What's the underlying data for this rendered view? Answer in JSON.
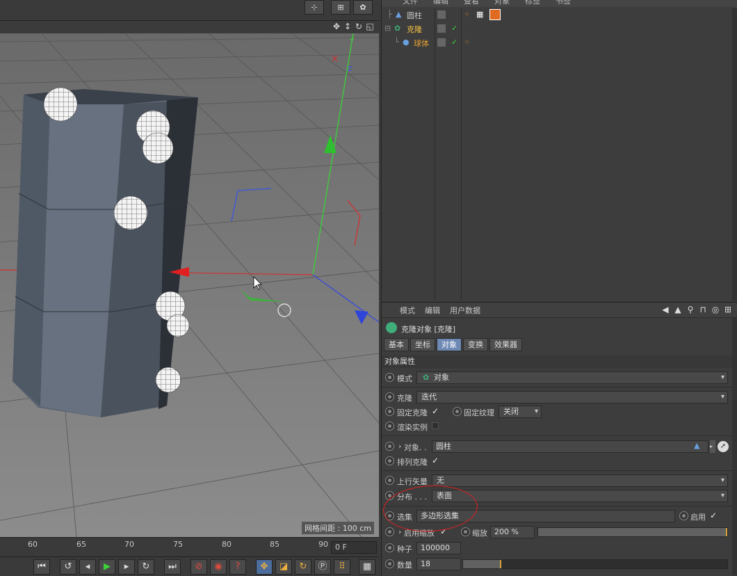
{
  "viewport": {
    "grid_spacing": "网格间距 : 100 cm"
  },
  "timeline": {
    "ticks": [
      "60",
      "65",
      "70",
      "75",
      "80",
      "85",
      "90"
    ],
    "frame": "0 F"
  },
  "object_manager": {
    "menu": [
      "文件",
      "编辑",
      "查看",
      "对象",
      "标签",
      "书签"
    ],
    "items": [
      {
        "name": "圆柱",
        "color": "#c8c8c8"
      },
      {
        "name": "克隆",
        "color": "#f0c040"
      },
      {
        "name": "球体",
        "color": "#e6a030"
      }
    ]
  },
  "attributes": {
    "menu": [
      "模式",
      "编辑",
      "用户数据"
    ],
    "title": "克隆对象 [克隆]",
    "tabs": [
      "基本",
      "坐标",
      "对象",
      "变换",
      "效果器"
    ],
    "active_tab": "对象",
    "section": "对象属性",
    "mode_label": "模式",
    "mode_value": "对象",
    "clone_label": "克隆",
    "clone_value": "迭代",
    "fix_clone_label": "固定克隆",
    "fix_texture_label": "固定纹理",
    "fix_texture_value": "关闭",
    "render_instance_label": "渲染实例",
    "object_label": "对象. .",
    "object_value": "圆柱",
    "arrange_label": "排列克隆",
    "up_vector_label": "上行矢量",
    "up_vector_value": "无",
    "distribution_label": "分布 . . .",
    "distribution_value": "表面",
    "selection_label": "选集",
    "selection_value": "多边形选集",
    "enable_label": "启用",
    "scale_enable_label": "启用缩放",
    "scale_label": "缩放",
    "scale_value": "200 %",
    "seed_label": "种子",
    "seed_value": "100000",
    "count_label": "数量",
    "count_value": "18",
    "count_fraction": 0.14
  }
}
